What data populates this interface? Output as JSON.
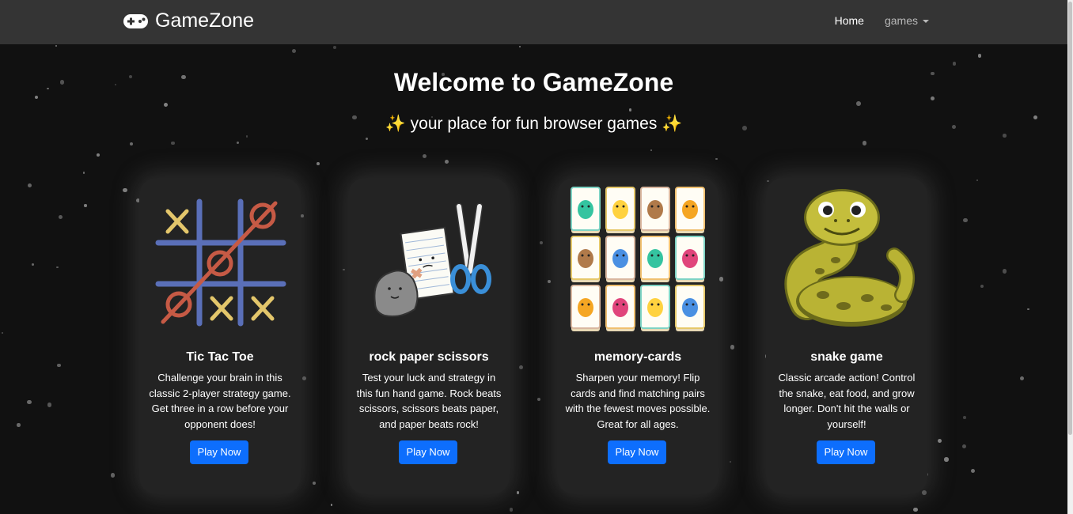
{
  "navbar": {
    "brand": "GameZone",
    "links": [
      {
        "label": "Home"
      },
      {
        "label": "games"
      }
    ]
  },
  "hero": {
    "title": "Welcome to GameZone",
    "sparkle": "✨",
    "subtitle": "your place for fun browser games"
  },
  "cards": [
    {
      "title": "Tic Tac Toe",
      "text": "Challenge your brain in this classic 2-player strategy game. Get three in a row before your opponent does!",
      "button": "Play Now"
    },
    {
      "title": "rock paper scissors",
      "text": "Test your luck and strategy in this fun hand game. Rock beats scissors, scissors beats paper, and paper beats rock!",
      "button": "Play Now"
    },
    {
      "title": "memory-cards",
      "text": "Sharpen your memory! Flip cards and find matching pairs with the fewest moves possible. Great for all ages.",
      "button": "Play Now"
    },
    {
      "title": "snake game",
      "text": "Classic arcade action! Control the snake, eat food, and grow longer. Don't hit the walls or yourself!",
      "button": "Play Now"
    }
  ],
  "colors": {
    "navbar": "#343434",
    "background": "#111111",
    "card": "#232323",
    "button": "#0d6efd"
  }
}
